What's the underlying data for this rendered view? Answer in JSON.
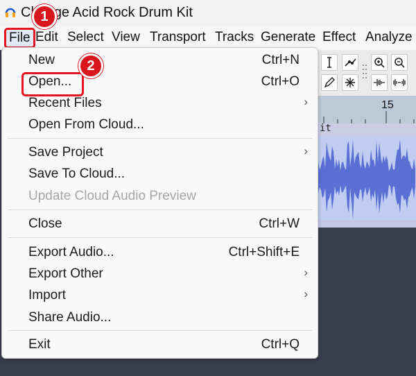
{
  "window": {
    "title": "Change Acid Rock Drum Kit"
  },
  "menubar": {
    "items": [
      "File",
      "Edit",
      "Select",
      "View",
      "Transport",
      "Tracks",
      "Generate",
      "Effect",
      "Analyze"
    ]
  },
  "file_menu": {
    "new": {
      "label": "New",
      "shortcut": "Ctrl+N"
    },
    "open": {
      "label": "Open...",
      "shortcut": "Ctrl+O"
    },
    "recent": {
      "label": "Recent Files"
    },
    "open_cloud": {
      "label": "Open From Cloud..."
    },
    "save_project": {
      "label": "Save Project"
    },
    "save_cloud": {
      "label": "Save To Cloud..."
    },
    "update_cloud": {
      "label": "Update Cloud Audio Preview"
    },
    "close": {
      "label": "Close",
      "shortcut": "Ctrl+W"
    },
    "export_audio": {
      "label": "Export Audio...",
      "shortcut": "Ctrl+Shift+E"
    },
    "export_other": {
      "label": "Export Other"
    },
    "import": {
      "label": "Import"
    },
    "share": {
      "label": "Share Audio..."
    },
    "exit": {
      "label": "Exit",
      "shortcut": "Ctrl+Q"
    },
    "submenu_arrow": "›"
  },
  "ruler": {
    "label": "15"
  },
  "track": {
    "name": "it"
  },
  "annotations": {
    "step1": "1",
    "step2": "2"
  },
  "colors": {
    "highlight": "#e8131f",
    "badge": "#d9151d",
    "waveform": "#5a6fd4",
    "track_bg": "#bfcdf0",
    "dark_bg": "#3a3d4c"
  },
  "icons": [
    "audacity-app-icon",
    "ibeam-tool-icon",
    "envelope-tool-icon",
    "zoom-in-icon",
    "zoom-out-icon",
    "pencil-tool-icon",
    "multi-tool-icon",
    "trim-audio-icon",
    "silence-audio-icon"
  ]
}
